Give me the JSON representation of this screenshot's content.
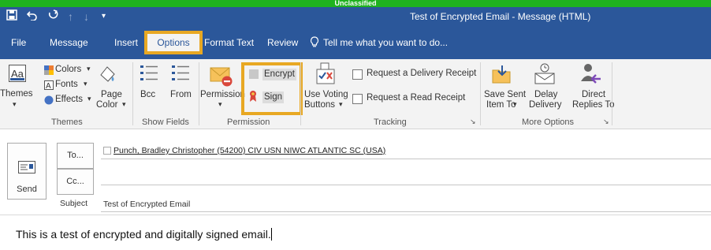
{
  "banner": {
    "text": "Unclassified"
  },
  "window": {
    "title": "Test of Encrypted Email - Message (HTML)"
  },
  "quick_access": [
    "save-icon",
    "undo-icon",
    "redo-icon",
    "up-arrow-icon",
    "down-arrow-icon",
    "customize-icon"
  ],
  "tabs": [
    {
      "label": "File"
    },
    {
      "label": "Message"
    },
    {
      "label": "Insert"
    },
    {
      "label": "Options"
    },
    {
      "label": "Format Text"
    },
    {
      "label": "Review"
    }
  ],
  "tell_me": "Tell me what you want to do...",
  "ribbon": {
    "themes": {
      "themes_label": "Themes",
      "colors": "Colors",
      "fonts": "Fonts",
      "effects": "Effects",
      "page": "Page",
      "color": "Color",
      "group": "Themes"
    },
    "show_fields": {
      "bcc": "Bcc",
      "from": "From",
      "group": "Show Fields"
    },
    "permission": {
      "permission": "Permission",
      "encrypt": "Encrypt",
      "sign": "Sign",
      "group": "Permission"
    },
    "tracking": {
      "use_voting": "Use Voting",
      "buttons": "Buttons",
      "delivery_receipt": "Request a Delivery Receipt",
      "read_receipt": "Request a Read Receipt",
      "group": "Tracking"
    },
    "more_options": {
      "save_sent": "Save Sent",
      "item_to": "Item To",
      "delay": "Delay",
      "delivery": "Delivery",
      "direct": "Direct",
      "replies_to": "Replies To",
      "group": "More Options"
    }
  },
  "compose": {
    "send": "Send",
    "to_button": "To...",
    "cc_button": "Cc...",
    "subject_label": "Subject",
    "to_value": "Punch, Bradley Christopher (54200) CIV USN NIWC ATLANTIC SC (USA)",
    "cc_value": "",
    "subject_value": "Test of Encrypted Email",
    "body": "This is a test of encrypted and digitally signed email."
  },
  "colors": {
    "accent": "#2b579a",
    "highlight": "#e8a823",
    "banner": "#1fb21f"
  }
}
